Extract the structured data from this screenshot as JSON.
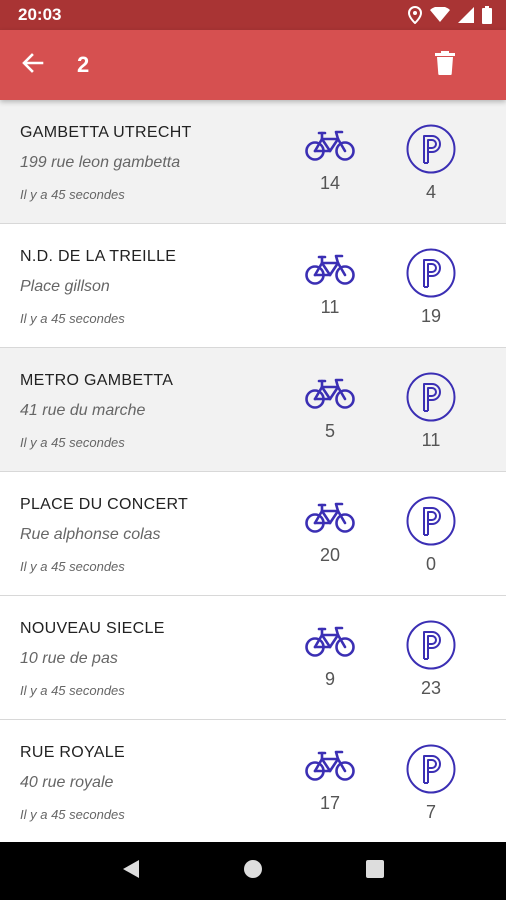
{
  "status_bar": {
    "time": "20:03",
    "icons": [
      "location-icon",
      "wifi-icon",
      "signal-icon",
      "battery-icon"
    ]
  },
  "app_bar": {
    "title": "2",
    "back_icon": "arrow-left-icon",
    "delete_icon": "trash-icon",
    "background": "#d65050",
    "status_background": "#a93434"
  },
  "stations": [
    {
      "name": "GAMBETTA UTRECHT",
      "address": "199 rue leon gambetta",
      "updated": "Il y a 45 secondes",
      "bikes": "14",
      "places": "4",
      "shaded": true
    },
    {
      "name": "N.D. DE LA TREILLE",
      "address": "Place gillson",
      "updated": "Il y a 45 secondes",
      "bikes": "11",
      "places": "19",
      "shaded": false
    },
    {
      "name": "METRO GAMBETTA",
      "address": "41 rue du marche",
      "updated": "Il y a 45 secondes",
      "bikes": "5",
      "places": "11",
      "shaded": true
    },
    {
      "name": "PLACE DU CONCERT",
      "address": "Rue alphonse colas",
      "updated": "Il y a 45 secondes",
      "bikes": "20",
      "places": "0",
      "shaded": false
    },
    {
      "name": "NOUVEAU SIECLE",
      "address": "10 rue de pas",
      "updated": "Il y a 45 secondes",
      "bikes": "9",
      "places": "23",
      "shaded": false
    },
    {
      "name": "RUE ROYALE",
      "address": "40 rue royale",
      "updated": "Il y a 45 secondes",
      "bikes": "17",
      "places": "7",
      "shaded": false
    }
  ],
  "icon_color": "#3b2fb4",
  "nav_bar": {
    "buttons": [
      "back-triangle-icon",
      "home-circle-icon",
      "recents-square-icon"
    ]
  }
}
